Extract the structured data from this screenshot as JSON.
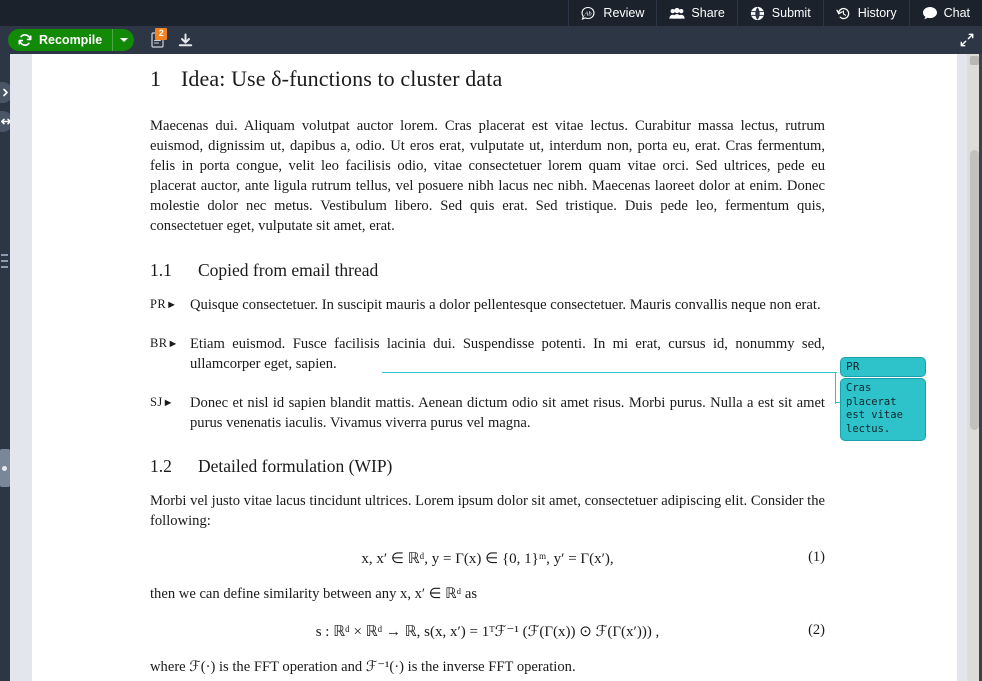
{
  "topnav": {
    "items": [
      {
        "label": "Review",
        "icon": "review-icon"
      },
      {
        "label": "Share",
        "icon": "share-icon"
      },
      {
        "label": "Submit",
        "icon": "submit-icon"
      },
      {
        "label": "History",
        "icon": "history-icon"
      },
      {
        "label": "Chat",
        "icon": "chat-icon"
      }
    ]
  },
  "toolbar": {
    "recompile_label": "Recompile",
    "recompile_color": "#138a07",
    "logs_badge": "2",
    "logs_icon": "log-file-icon",
    "download_icon": "download-icon",
    "expand_icon": "expand-arrows-icon"
  },
  "document": {
    "section": {
      "number": "1",
      "title": "Idea: Use δ-functions to cluster data"
    },
    "intro_paragraph": "Maecenas dui. Aliquam volutpat auctor lorem. Cras placerat est vitae lectus. Curabitur massa lectus, rutrum euismod, dignissim ut, dapibus a, odio. Ut eros erat, vulputate ut, interdum non, porta eu, erat. Cras fermentum, felis in porta congue, velit leo facilisis odio, vitae consectetuer lorem quam vitae orci. Sed ultrices, pede eu placerat auctor, ante ligula rutrum tellus, vel posuere nibh lacus nec nibh. Maecenas laoreet dolor at enim. Donec molestie dolor nec metus. Vestibulum libero. Sed quis erat. Sed tristique. Duis pede leo, fermentum quis, consectetuer eget, vulputate sit amet, erat.",
    "subsection1": {
      "number": "1.1",
      "title": "Copied from email thread"
    },
    "email_items": [
      {
        "tag": "PR",
        "text": "Quisque consectetuer. In suscipit mauris a dolor pellentesque consectetuer. Mauris convallis neque non erat."
      },
      {
        "tag": "BR",
        "text": "Etiam euismod. Fusce facilisis lacinia dui. Suspendisse potenti. In mi erat, cursus id, nonummy sed, ullamcorper eget, sapien."
      },
      {
        "tag": "SJ",
        "text": "Donec et nisl id sapien blandit mattis. Aenean dictum odio sit amet risus. Morbi purus. Nulla a est sit amet purus venenatis iaculis. Vivamus viverra purus vel magna."
      }
    ],
    "subsection2": {
      "number": "1.2",
      "title": "Detailed formulation (WIP)"
    },
    "para_before_eq1": "Morbi vel justo vitae lacus tincidunt ultrices. Lorem ipsum dolor sit amet, consectetuer adipiscing elit. Consider the following:",
    "equation1": {
      "number": "(1)",
      "text": "x, x′ ∈ ℝᵈ, y = Γ(x) ∈ {0, 1}ᵐ, y′ = Γ(x′),"
    },
    "para_between_eqs": "then we can define similarity between any x, x′ ∈ ℝᵈ as",
    "equation2": {
      "number": "(2)",
      "text": "s : ℝᵈ × ℝᵈ → ℝ, s(x, x′) = 1ᵀℱ⁻¹ (ℱ(Γ(x)) ⊙ ℱ(Γ(x′))) ,"
    },
    "para_after_eq2": "where ℱ(·) is the FFT operation and ℱ⁻¹(·) is the inverse FFT operation."
  },
  "comment": {
    "author": "PR",
    "text": "Cras placerat est vitae lectus.",
    "color": "#2ec2ca"
  },
  "sidebar": {
    "toggle_icons": [
      "chevron-right-icon",
      "arrows-left-right-icon"
    ]
  }
}
